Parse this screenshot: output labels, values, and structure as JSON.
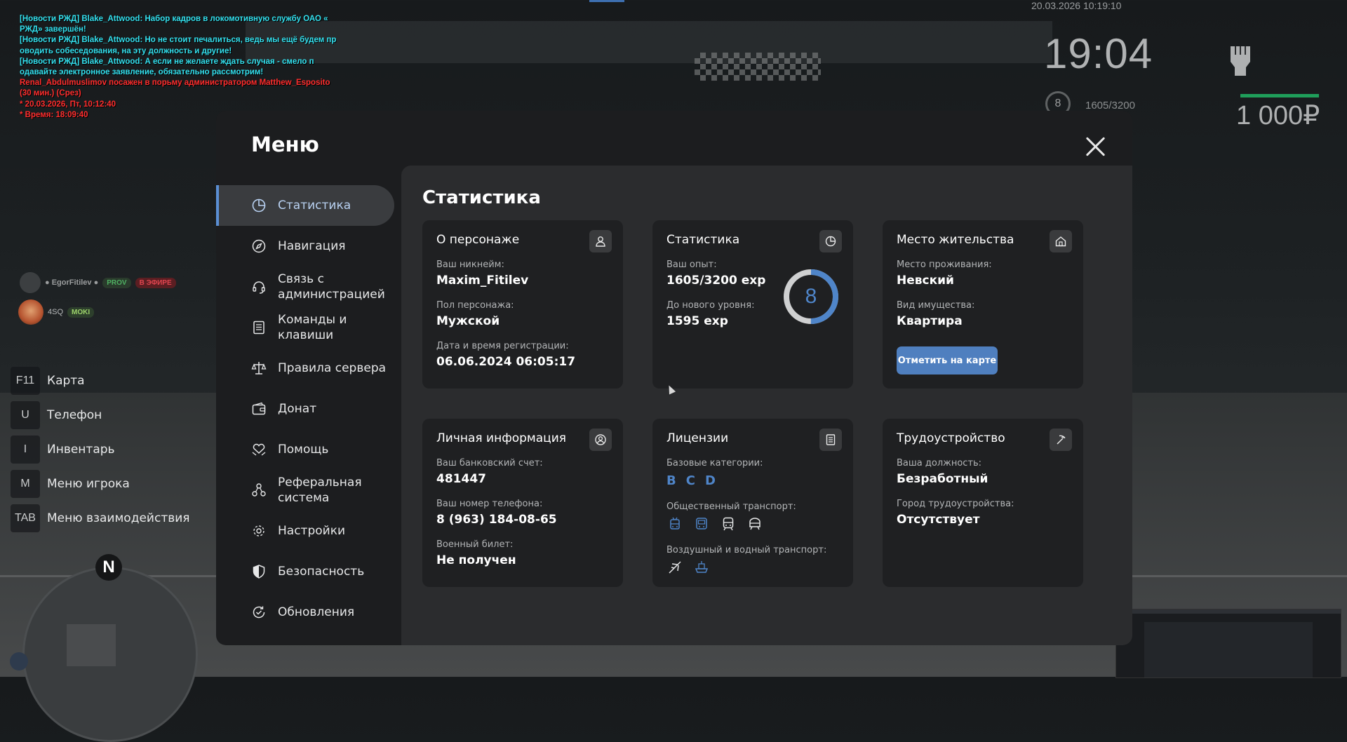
{
  "chat": [
    {
      "text": "[Новости РЖД] Blake_Attwood: Набор кадров в локомотивную службу ОАО «",
      "color": "cyan"
    },
    {
      "text": "РЖД» завершён!",
      "color": "cyan"
    },
    {
      "text": "[Новости РЖД] Blake_Attwood: Но не стоит печалиться, ведь мы ещё будем пр",
      "color": "cyan"
    },
    {
      "text": "оводить собеседования, на эту должность и другие!",
      "color": "cyan"
    },
    {
      "text": "[Новости РЖД] Blake_Attwood: А если не желаете ждать случая - смело п",
      "color": "cyan"
    },
    {
      "text": "одавайте электронное заявление, обязательно рассмотрим!",
      "color": "cyan"
    },
    {
      "text": "Renal_Abdulmuslimov посажен в порьму администратором Matthew_Esposito",
      "color": "red"
    },
    {
      "text": "(30 мин.) (Срез)",
      "color": "red"
    },
    {
      "text": "* 20.03.2026, Пт, 10:12:40",
      "color": "red"
    },
    {
      "text": "* Время: 18:09:40",
      "color": "red"
    }
  ],
  "hud": {
    "date": "20.03.2026 10:19:10",
    "time": "19:04",
    "level": "8",
    "exp": "1605/3200",
    "money": "1 000₽"
  },
  "players": [
    {
      "name": "● EgorFitilev ●",
      "badges": [
        "PROV",
        "В ЭФИРЕ"
      ]
    },
    {
      "name": "4SQ",
      "badges": [
        "MOKI"
      ]
    }
  ],
  "hotkeys": [
    {
      "key": "F11",
      "label": "Карта"
    },
    {
      "key": "U",
      "label": "Телефон"
    },
    {
      "key": "I",
      "label": "Инвентарь"
    },
    {
      "key": "M",
      "label": "Меню игрока"
    },
    {
      "key": "TAB",
      "label": "Меню взаимодействия"
    }
  ],
  "minimap": {
    "north": "N"
  },
  "menu": {
    "title": "Меню",
    "nav": [
      {
        "label": "Статистика",
        "icon": "pie-chart-icon",
        "active": true
      },
      {
        "label": "Навигация",
        "icon": "compass-icon"
      },
      {
        "label": "Связь с администрацией",
        "icon": "headset-icon"
      },
      {
        "label": "Команды и клавиши",
        "icon": "document-list-icon"
      },
      {
        "label": "Правила сервера",
        "icon": "scales-icon"
      },
      {
        "label": "Донат",
        "icon": "wallet-icon"
      },
      {
        "label": "Помощь",
        "icon": "heart-hands-icon"
      },
      {
        "label": "Реферальная система",
        "icon": "network-icon"
      },
      {
        "label": "Настройки",
        "icon": "gear-icon"
      },
      {
        "label": "Безопасность",
        "icon": "shield-icon"
      },
      {
        "label": "Обновления",
        "icon": "refresh-check-icon"
      }
    ],
    "content_title": "Статистика",
    "cards": {
      "character": {
        "title": "О персонаже",
        "nickname_label": "Ваш никнейм:",
        "nickname": "Maxim_Fitilev",
        "gender_label": "Пол персонажа:",
        "gender": "Мужской",
        "reg_label": "Дата и время регистрации:",
        "reg": "06.06.2024 06:05:17"
      },
      "stats": {
        "title": "Статистика",
        "exp_label": "Ваш опыт:",
        "exp": "1605/3200 exp",
        "next_label": "До нового уровня:",
        "next": "1595 exp",
        "level": "8",
        "progress": 0.5
      },
      "residence": {
        "title": "Место жительства",
        "place_label": "Место проживания:",
        "place": "Невский",
        "property_label": "Вид имущества:",
        "property": "Квартира",
        "button": "Отметить на карте"
      },
      "personal": {
        "title": "Личная информация",
        "bank_label": "Ваш банковский счет:",
        "bank": "481447",
        "phone_label": "Ваш номер телефона:",
        "phone": "8 (963) 184-08-65",
        "military_label": "Военный билет:",
        "military": "Не получен"
      },
      "licenses": {
        "title": "Лицензии",
        "base_label": "Базовые категории:",
        "categories": [
          "B",
          "C",
          "D"
        ],
        "public_label": "Общественный транспорт:",
        "air_label": "Воздушный и водный транспорт:"
      },
      "employment": {
        "title": "Трудоустройство",
        "position_label": "Ваша должность:",
        "position": "Безработный",
        "city_label": "Город трудоустройства:",
        "city": "Отсутствует"
      }
    }
  },
  "colors": {
    "accent": "#4f85c9",
    "button": "#4f7fbf",
    "panel": "#1f2022"
  }
}
